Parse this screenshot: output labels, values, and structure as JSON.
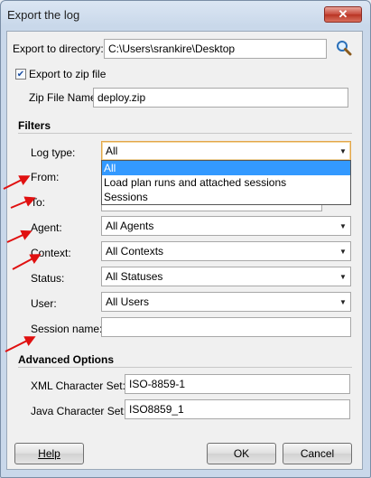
{
  "window": {
    "title": "Export the log",
    "close_glyph": "✕"
  },
  "export": {
    "dir_label": "Export to directory:",
    "dir_value": "C:\\Users\\srankire\\Desktop",
    "zip_checkbox_label": "Export to zip file",
    "zip_checked": true,
    "zip_name_label": "Zip File Name:",
    "zip_name_value": "deploy.zip"
  },
  "filters": {
    "section_label": "Filters",
    "log_type_label": "Log type:",
    "log_type_value": "All",
    "log_type_options": [
      "All",
      "Load plan runs and attached sessions",
      "Sessions"
    ],
    "from_label": "From:",
    "to_label": "To:",
    "agent_label": "Agent:",
    "agent_value": "All Agents",
    "context_label": "Context:",
    "context_value": "All Contexts",
    "status_label": "Status:",
    "status_value": "All Statuses",
    "user_label": "User:",
    "user_value": "All Users",
    "session_name_label": "Session name:",
    "session_name_value": ""
  },
  "advanced": {
    "section_label": "Advanced Options",
    "xml_charset_label": "XML Character Set:",
    "xml_charset_value": "ISO-8859-1",
    "java_charset_label": "Java Character Set:",
    "java_charset_value": "ISO8859_1"
  },
  "buttons": {
    "help": "Help",
    "ok": "OK",
    "cancel": "Cancel"
  },
  "colors": {
    "annotation_arrow": "#e01010",
    "selection": "#3399ff"
  }
}
